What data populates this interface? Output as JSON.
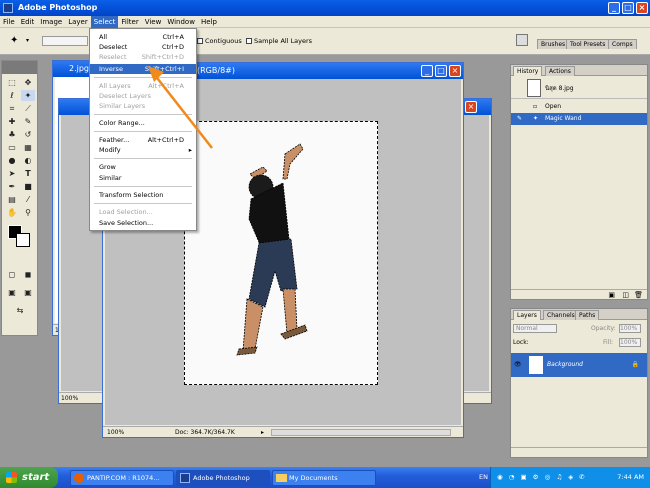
{
  "app": {
    "title": "Adobe Photoshop"
  },
  "menubar": [
    "File",
    "Edit",
    "Image",
    "Layer",
    "Select",
    "Filter",
    "View",
    "Window",
    "Help"
  ],
  "options": {
    "contiguous_label": "Contiguous",
    "sample_all_label": "Sample All Layers",
    "top_tabs": [
      "Brushes",
      "Tool Presets",
      "Comps"
    ]
  },
  "select_menu": {
    "items": [
      {
        "label": "All",
        "shortcut": "Ctrl+A",
        "state": "normal"
      },
      {
        "label": "Deselect",
        "shortcut": "Ctrl+D",
        "state": "normal"
      },
      {
        "label": "Reselect",
        "shortcut": "Shift+Ctrl+D",
        "state": "disabled"
      },
      {
        "label": "Inverse",
        "shortcut": "Shift+Ctrl+I",
        "state": "highlighted"
      },
      {
        "label": "All Layers",
        "shortcut": "Alt+Ctrl+A",
        "state": "disabled"
      },
      {
        "label": "Deselect Layers",
        "shortcut": "",
        "state": "disabled"
      },
      {
        "label": "Similar Layers",
        "shortcut": "",
        "state": "disabled"
      },
      {
        "label": "Color Range...",
        "shortcut": "",
        "state": "normal"
      },
      {
        "label": "Feather...",
        "shortcut": "Alt+Ctrl+D",
        "state": "normal"
      },
      {
        "label": "Modify",
        "shortcut": "▸",
        "state": "normal"
      },
      {
        "label": "Grow",
        "shortcut": "",
        "state": "normal"
      },
      {
        "label": "Similar",
        "shortcut": "",
        "state": "normal"
      },
      {
        "label": "Transform Selection",
        "shortcut": "",
        "state": "normal"
      },
      {
        "label": "Load Selection...",
        "shortcut": "",
        "state": "disabled"
      },
      {
        "label": "Save Selection...",
        "shortcut": "",
        "state": "normal"
      }
    ]
  },
  "doc_back": {
    "title": "2.jpg",
    "zoom": "100%"
  },
  "doc_back2": {
    "zoom": "100%"
  },
  "doc_main": {
    "title_suffix": "(RGB/8#)",
    "zoom": "100%",
    "doc_info": "Doc: 364.7K/364.7K"
  },
  "history": {
    "tabs": [
      "History",
      "Actions"
    ],
    "snapshot": "นิสุด 8.jpg",
    "items": [
      {
        "label": "Open"
      },
      {
        "label": "Magic Wand"
      }
    ]
  },
  "layers": {
    "tabs": [
      "Layers",
      "Channels",
      "Paths"
    ],
    "mode": "Normal",
    "opacity_label": "Opacity:",
    "opacity": "100%",
    "lock_label": "Lock:",
    "fill_label": "Fill:",
    "fill": "100%",
    "layer_name": "Background"
  },
  "taskbar": {
    "start": "start",
    "tasks": [
      "PANTIP.COM : R1074...",
      "Adobe Photoshop",
      "My Documents"
    ],
    "lang": "EN",
    "time": "7:44 AM"
  }
}
